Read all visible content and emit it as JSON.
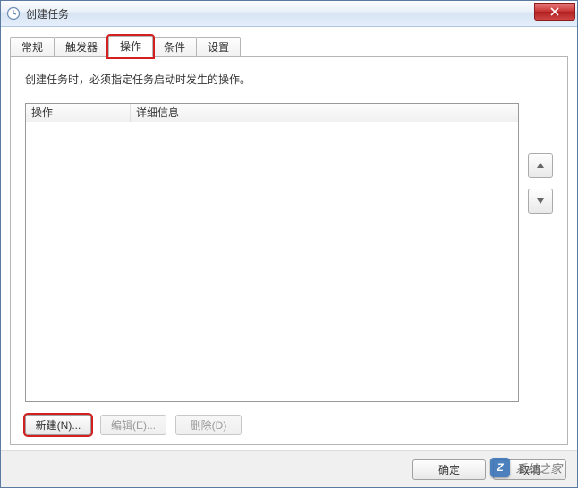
{
  "window": {
    "title": "创建任务",
    "icon_name": "clock-icon"
  },
  "tabs": [
    {
      "label": "常规",
      "active": false
    },
    {
      "label": "触发器",
      "active": false
    },
    {
      "label": "操作",
      "active": true
    },
    {
      "label": "条件",
      "active": false
    },
    {
      "label": "设置",
      "active": false
    }
  ],
  "panel": {
    "instruction": "创建任务时，必须指定任务启动时发生的操作。",
    "columns": {
      "action": "操作",
      "details": "详细信息"
    },
    "rows": []
  },
  "side": {
    "up_tip": "上移",
    "down_tip": "下移"
  },
  "buttons": {
    "new": "新建(N)...",
    "edit": "编辑(E)...",
    "delete": "删除(D)"
  },
  "footer": {
    "ok": "确定",
    "cancel": "取消"
  },
  "watermark": {
    "text": "系统之家",
    "url_hint": "xitongzhijia.net"
  }
}
